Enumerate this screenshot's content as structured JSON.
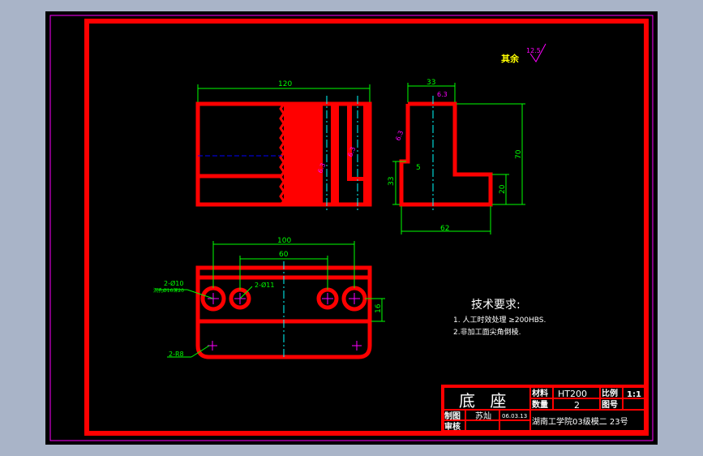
{
  "drawing": {
    "note_surface": "其余",
    "note_surface_roughness": "12.5",
    "tech_req": {
      "title": "技术要求:",
      "items": [
        "1. 人工时效处理 ≥200HBS.",
        "2.非加工面尖角倒棱."
      ]
    },
    "dims": {
      "top_width": "120",
      "side_width": "33",
      "side_height": "70",
      "side_base": "62",
      "side_step_h": "33",
      "side_thk": "20",
      "side_5": "5",
      "rough_side_1": "6.3",
      "rough_side_2": "6.3",
      "rough_top_1": "6.3",
      "rough_top_2": "6.3",
      "plan_100": "100",
      "plan_60": "60",
      "plan_16": "16",
      "hole_1": "2-Ø10",
      "hole_1b": "沉孔Ø16深20",
      "hole_2": "2-Ø11",
      "radius": "2-R8"
    },
    "title_block": {
      "part_name": "底 座",
      "material_label": "材料",
      "material_value": "HT200",
      "scale_label": "比例",
      "scale_value": "1:1",
      "qty_label": "数量",
      "qty_value": "2",
      "drawing_no_label": "图号",
      "drawing_no_value": "",
      "drawn_label": "制图",
      "drawn_value": "苏灿",
      "date_value": "06.03.13",
      "check_label": "审核",
      "school": "湖南工学院03级模二 23号"
    }
  },
  "colors": {
    "background": "#000000",
    "outline": "#ff0000",
    "dimension": "#00ff00",
    "center": "#00ffff",
    "roughness": "#ff00ff",
    "text": "#ffffff",
    "window_bg": "#a9b4c8"
  }
}
